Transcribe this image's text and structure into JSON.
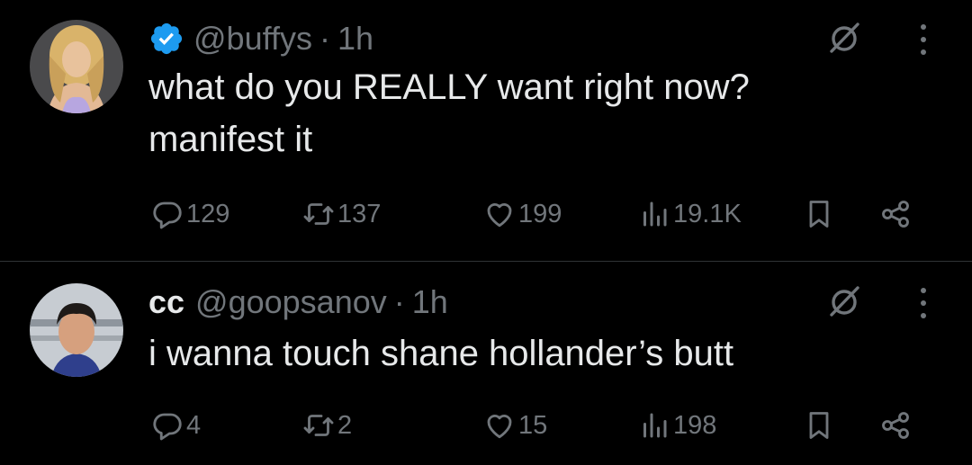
{
  "tweets": [
    {
      "display_name": "",
      "handle": "@buffys",
      "separator": "·",
      "time": "1h",
      "verified": true,
      "text_lines": [
        "what do you REALLY want right now?",
        "manifest it"
      ],
      "replies": "129",
      "reposts": "137",
      "likes": "199",
      "views": "19.1K"
    },
    {
      "display_name": "cc",
      "handle": "@goopsanov",
      "separator": "·",
      "time": "1h",
      "verified": false,
      "text_lines": [
        "i wanna touch shane hollander’s butt"
      ],
      "replies": "4",
      "reposts": "2",
      "likes": "15",
      "views": "198"
    }
  ],
  "icons": {
    "verified": "verified-badge-icon",
    "grok": "grok-icon",
    "more": "more-icon",
    "reply": "reply-icon",
    "repost": "repost-icon",
    "like": "like-icon",
    "views": "views-icon",
    "bookmark": "bookmark-icon",
    "share": "share-icon"
  },
  "colors": {
    "background": "#000000",
    "text": "#e7e9ea",
    "secondary": "#71767b",
    "verified": "#1d9bf0",
    "divider": "#2f3336"
  }
}
